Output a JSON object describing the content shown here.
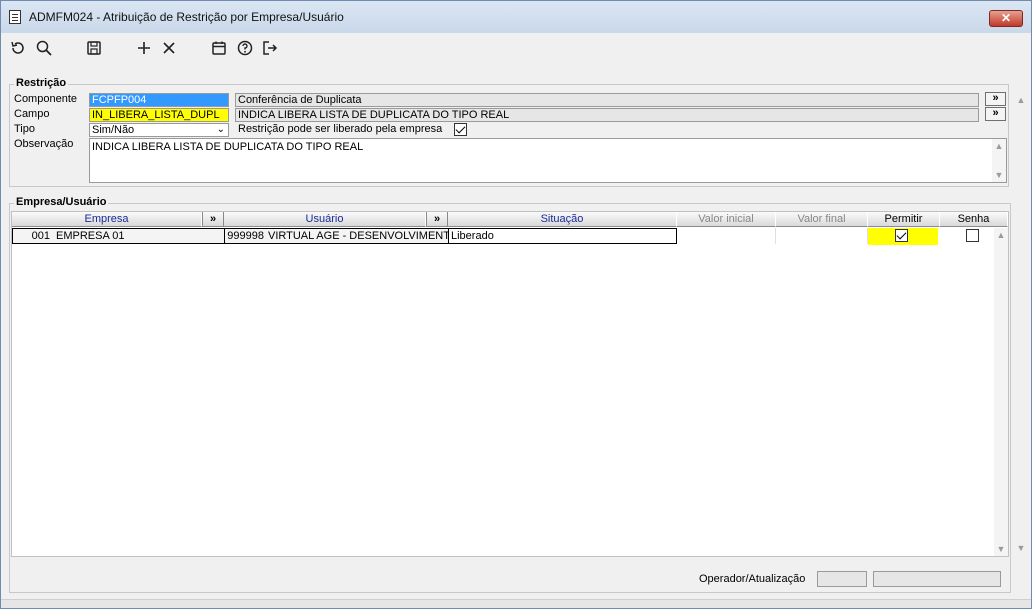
{
  "window": {
    "title": "ADMFM024 - Atribuição de Restrição por Empresa/Usuário",
    "close_label": "✕"
  },
  "toolbar": {
    "icons": [
      "undo-icon",
      "search-icon",
      "save-icon",
      "add-icon",
      "delete-icon",
      "calendar-icon",
      "help-icon",
      "exit-icon"
    ]
  },
  "restricao": {
    "group_title": "Restrição",
    "componente_label": "Componente",
    "componente_code": "FCPFP004",
    "componente_desc": "Conferência de Duplicata",
    "campo_label": "Campo",
    "campo_code": "IN_LIBERA_LISTA_DUPL",
    "campo_desc": "INDICA LIBERA LISTA DE DUPLICATA DO TIPO REAL",
    "tipo_label": "Tipo",
    "tipo_value": "Sim/Não",
    "liberado_label": "Restrição pode ser liberado pela empresa",
    "observacao_label": "Observação",
    "observacao_value": "INDICA LIBERA LISTA DE DUPLICATA DO TIPO REAL",
    "expand_label": "»"
  },
  "empresa_usuario": {
    "group_title": "Empresa/Usuário",
    "columns": {
      "empresa": "Empresa",
      "usuario": "Usuário",
      "situacao": "Situação",
      "valor_inicial": "Valor inicial",
      "valor_final": "Valor final",
      "permitir": "Permitir",
      "senha": "Senha",
      "expand": "»"
    },
    "rows": [
      {
        "empresa_code": "001",
        "empresa_name": "EMPRESA 01",
        "usuario_code": "999998",
        "usuario_name": "VIRTUAL AGE - DESENVOLVIMENTO",
        "situacao": "Liberado",
        "valor_inicial": "",
        "valor_final": "",
        "permitir": true,
        "senha": false
      }
    ]
  },
  "status": {
    "operador_label": "Operador/Atualização"
  },
  "colors": {
    "selection": "#3399ff",
    "highlight": "#ffff00",
    "header_text": "#1a2a9a"
  }
}
